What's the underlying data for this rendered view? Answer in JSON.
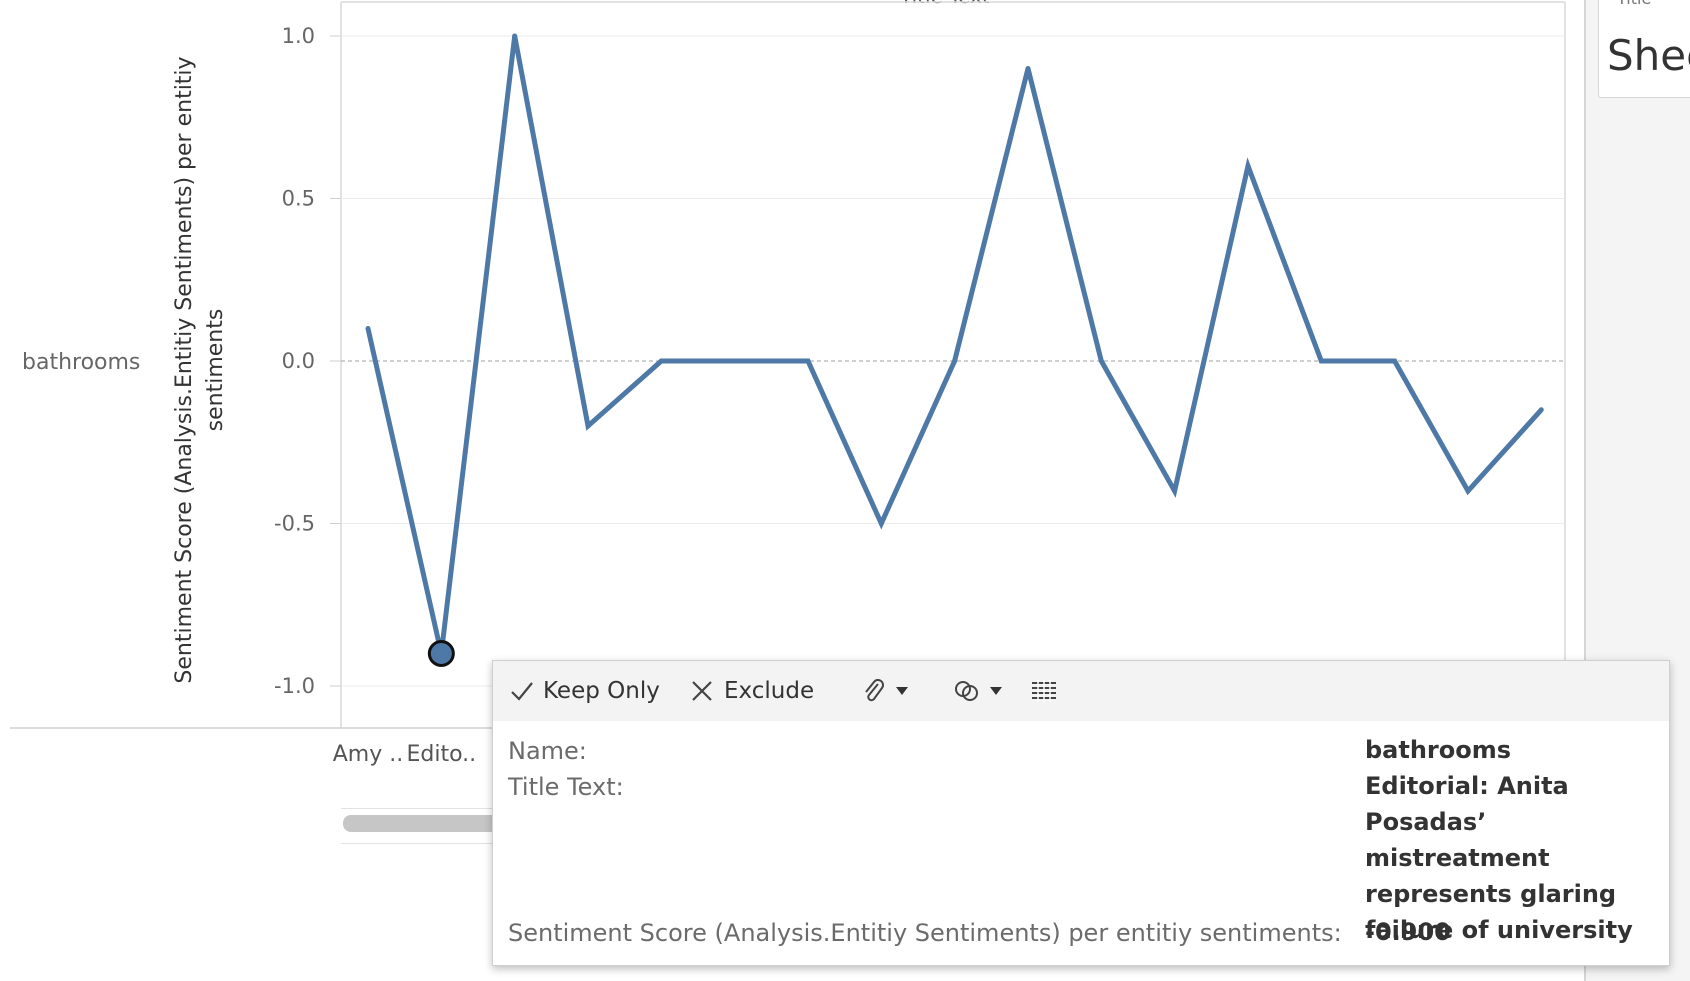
{
  "row_header": "bathrooms",
  "top_clipped_title": "Title Text",
  "y_axis_title_line1": "Sentiment Score (Analysis.Entitiy Sentiments) per entitiy",
  "y_axis_title_line2": "sentiments",
  "sheet_panel": {
    "card_label": "Title",
    "card_title": "Shee"
  },
  "chart_data": {
    "type": "line",
    "title": "",
    "ylabel": "Sentiment Score (Analysis.Entitiy Sentiments) per entitiy sentiments",
    "xlabel": "",
    "ylim": [
      -1.0,
      1.0
    ],
    "yticks": [
      1.0,
      0.5,
      0.0,
      -0.5,
      -1.0
    ],
    "ytick_labels": [
      "1.0",
      "0.5",
      "0.0",
      "-0.5",
      "-1.0"
    ],
    "x_visible_labels": [
      "Amy ..",
      "Edito.."
    ],
    "grid": true,
    "color": "#4e79a7",
    "series": [
      {
        "values": [
          0.1,
          -0.9,
          1.0,
          -0.2,
          0.0,
          0.0,
          0.0,
          -0.5,
          0.0,
          0.9,
          0.0,
          -0.4,
          0.6,
          0.0,
          0.0,
          -0.4,
          -0.15
        ]
      }
    ],
    "highlighted_index": 1
  },
  "tooltip": {
    "keep_only": "Keep Only",
    "exclude": "Exclude",
    "name_label": "Name:",
    "name_value": "bathrooms",
    "title_label": "Title Text:",
    "title_value": "Editorial: Anita Posadas’ mistreatment represents glaring failure of university",
    "score_label": "Sentiment Score (Analysis.Entitiy Sentiments) per entitiy sentiments:",
    "score_value": "-0.900"
  }
}
